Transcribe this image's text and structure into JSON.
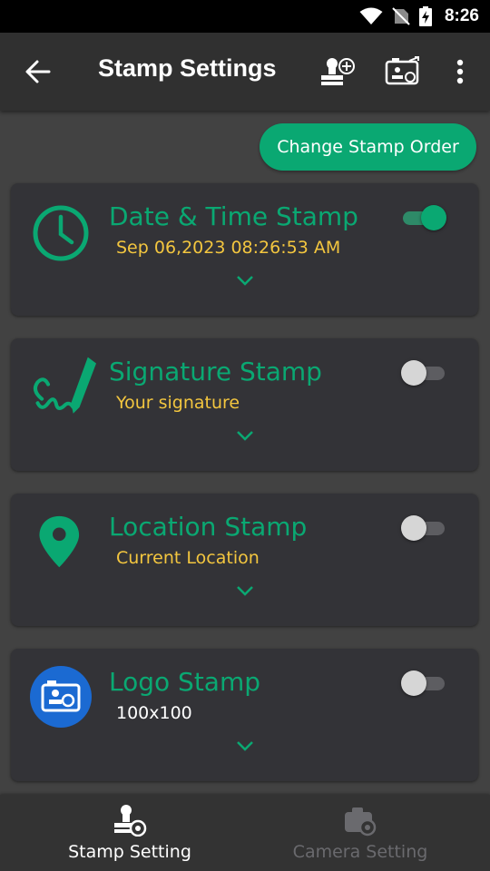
{
  "status_bar": {
    "time": "8:26"
  },
  "app_bar": {
    "title": "Stamp Settings",
    "back_icon": "arrow-left-icon",
    "actions": [
      "add-stamp-icon",
      "stamp-preview-icon",
      "more-vert-icon"
    ]
  },
  "change_order_button": {
    "label": "Change Stamp Order"
  },
  "colors": {
    "accent": "#0aa872",
    "subtitle_yellow": "#f3c63f",
    "subtitle_white": "#ffffff",
    "logo_circle": "#1b6ad2",
    "nav_active": "#ffffff",
    "nav_inactive": "#6a6a6e"
  },
  "stamps": [
    {
      "name": "Date & Time Stamp",
      "subtitle": "Sep 06,2023 08:26:53 AM",
      "icon": "clock-icon",
      "enabled": true
    },
    {
      "name": "Signature Stamp",
      "subtitle": "Your signature",
      "icon": "signature-pen-icon",
      "enabled": false
    },
    {
      "name": "Location Stamp",
      "subtitle": "Current Location",
      "icon": "location-pin-icon",
      "enabled": false
    },
    {
      "name": "Logo Stamp",
      "subtitle": "100x100",
      "icon": "logo-stamp-icon",
      "enabled": false
    }
  ],
  "bottom_nav": [
    {
      "label": "Stamp Setting",
      "icon": "stamp-gear-icon",
      "active": true
    },
    {
      "label": "Camera Setting",
      "icon": "camera-gear-icon",
      "active": false
    }
  ]
}
